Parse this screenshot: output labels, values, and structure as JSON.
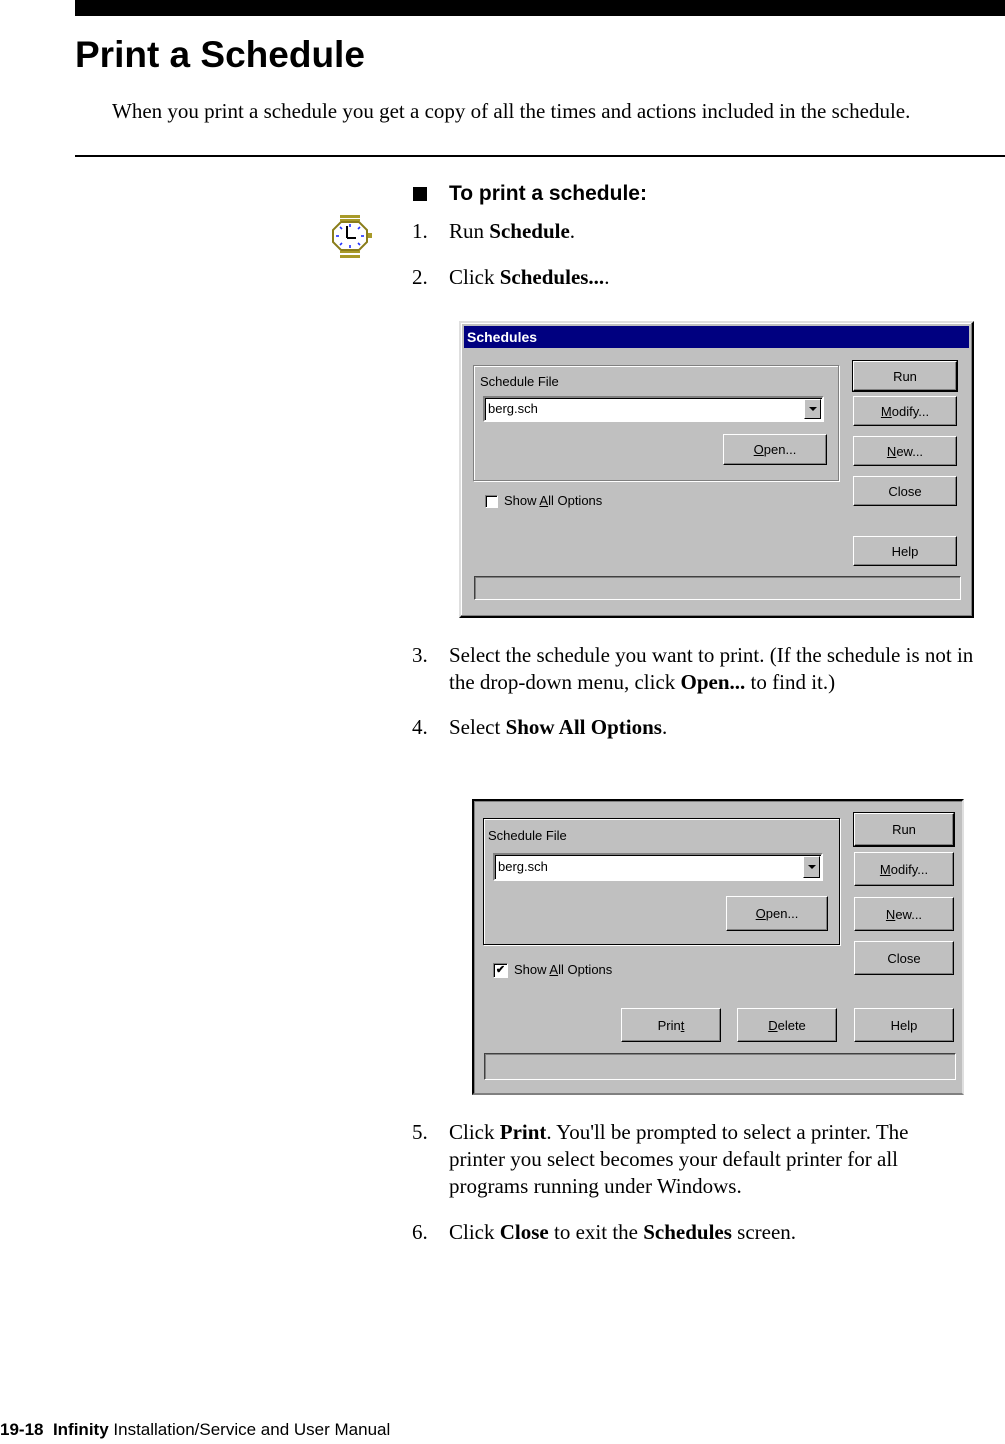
{
  "page": {
    "title": "Print a Schedule",
    "intro": "When you print a schedule you get a copy of all the times and actions included in the schedule."
  },
  "procedure": {
    "heading": "To print a schedule:",
    "icon": "stopwatch-icon",
    "steps": [
      {
        "num": "1.",
        "parts": [
          "Run ",
          "Schedule",
          "."
        ]
      },
      {
        "num": "2.",
        "parts": [
          "Click ",
          "Schedules...",
          "."
        ]
      },
      {
        "num": "3.",
        "parts": [
          "Select the schedule you want to print. (If the schedule is not in the drop-down menu, click ",
          "Open...",
          " to find it.)"
        ]
      },
      {
        "num": "4.",
        "parts": [
          "Select ",
          "Show All Options",
          "."
        ]
      },
      {
        "num": "5.",
        "parts": [
          "Click ",
          "Print",
          ". You'll be prompted to select a printer. The printer you select becomes your default printer for all programs running under Windows."
        ]
      },
      {
        "num": "6.",
        "parts": [
          "Click ",
          "Close",
          " to exit the ",
          "Schedules",
          " screen."
        ]
      }
    ]
  },
  "dialog1": {
    "title": "Schedules",
    "group_label": "Schedule File",
    "file_value": "berg.sch",
    "open_button": {
      "pre": "",
      "mnemonic": "O",
      "post": "pen..."
    },
    "show_all_label": {
      "pre": "Show ",
      "mnemonic": "A",
      "post": "ll Options"
    },
    "show_all_checked": false,
    "buttons": {
      "run": "Run",
      "modify": {
        "pre": "",
        "mnemonic": "M",
        "post": "odify..."
      },
      "new": {
        "pre": "",
        "mnemonic": "N",
        "post": "ew..."
      },
      "close": "Close",
      "help": "Help"
    },
    "colors": {
      "titlebar": "#000080",
      "face": "#c0c0c0"
    }
  },
  "dialog2": {
    "group_label": "Schedule File",
    "file_value": "berg.sch",
    "open_button": {
      "pre": "",
      "mnemonic": "O",
      "post": "pen..."
    },
    "show_all_label": {
      "pre": "Show ",
      "mnemonic": "A",
      "post": "ll Options"
    },
    "show_all_checked": true,
    "check_mark": "✔",
    "buttons": {
      "run": "Run",
      "modify": {
        "pre": "",
        "mnemonic": "M",
        "post": "odify..."
      },
      "new": {
        "pre": "",
        "mnemonic": "N",
        "post": "ew..."
      },
      "close": "Close",
      "print": {
        "pre": "Prin",
        "mnemonic": "t",
        "post": ""
      },
      "delete": {
        "pre": "",
        "mnemonic": "D",
        "post": "elete"
      },
      "help": "Help"
    }
  },
  "footer": {
    "page_number": "19-18",
    "product": "Infinity",
    "manual": "Installation/Service and User Manual"
  }
}
